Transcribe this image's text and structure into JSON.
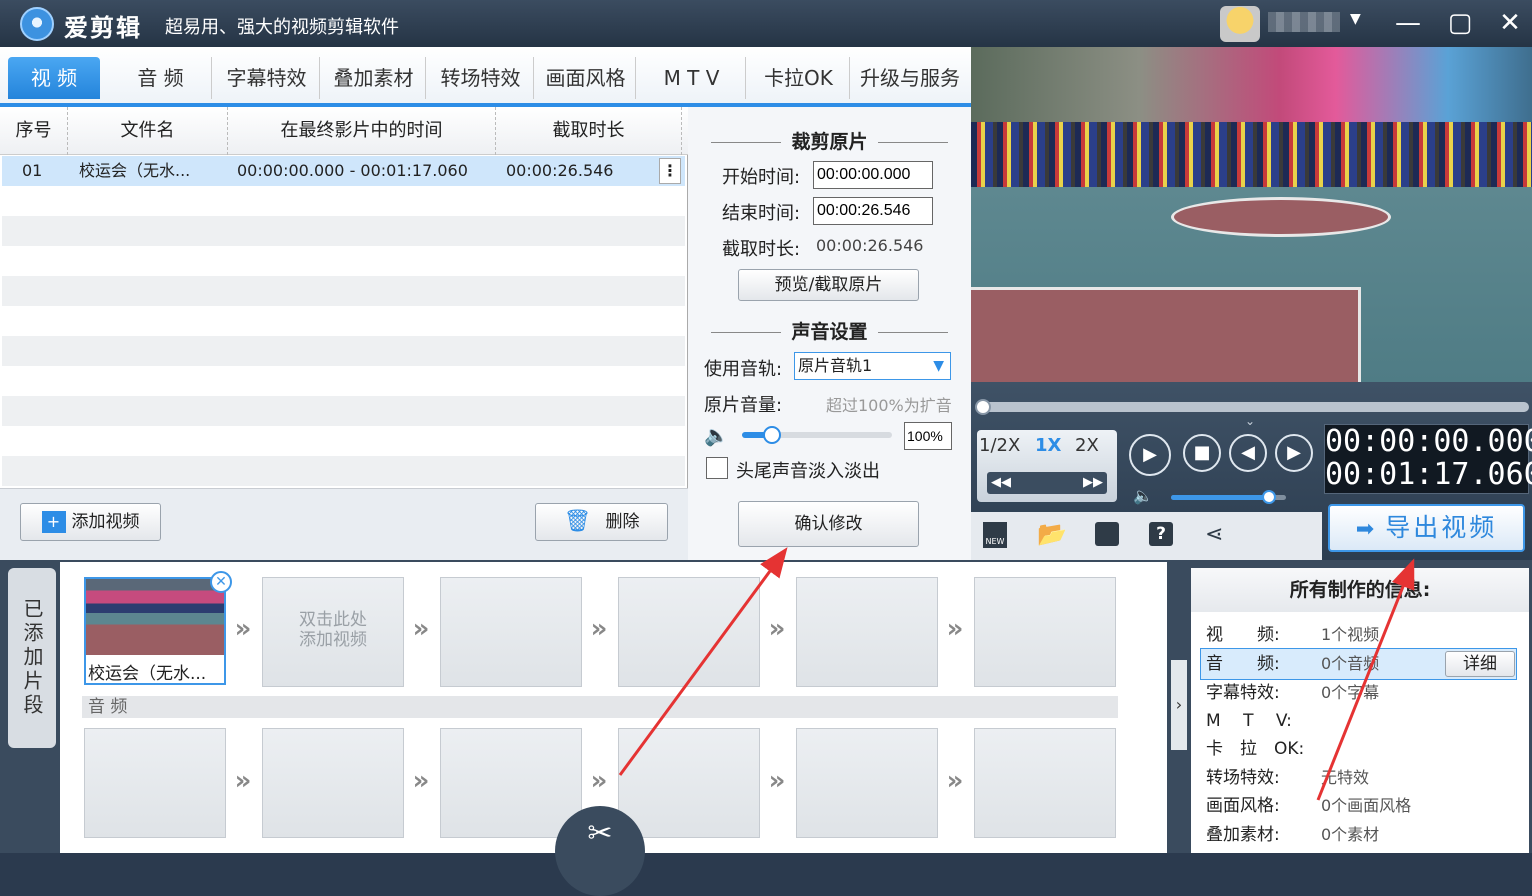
{
  "titlebar": {
    "app_name": "爱剪辑",
    "slogan": "超易用、强大的视频剪辑软件",
    "minimize": "—",
    "maximize": "▢",
    "close": "✕"
  },
  "tabs": [
    "视 频",
    "音 频",
    "字幕特效",
    "叠加素材",
    "转场特效",
    "画面风格",
    "M T V",
    "卡拉OK",
    "升级与服务"
  ],
  "table": {
    "headers": [
      "序号",
      "文件名",
      "在最终影片中的时间",
      "截取时长"
    ],
    "rows": [
      {
        "index": "01",
        "filename": "校运会（无水...",
        "time_range": "00:00:00.000 - 00:01:17.060",
        "duration": "00:00:26.546"
      }
    ]
  },
  "list_footer": {
    "add_video": "添加视频",
    "delete": "删除"
  },
  "edit": {
    "clip_section": "裁剪原片",
    "start_label": "开始时间:",
    "start_value": "00:00:00.000",
    "end_label": "结束时间:",
    "end_value": "00:00:26.546",
    "dur_label": "截取时长:",
    "dur_value": "00:00:26.546",
    "preview_btn": "预览/截取原片",
    "audio_section": "声音设置",
    "track_label": "使用音轨:",
    "track_value": "原片音轨1",
    "volume_label": "原片音量:",
    "volume_hint": "超过100%为扩音",
    "volume_value": "100%",
    "volume_level": 0.2,
    "fade_label": "头尾声音淡入淡出",
    "confirm_btn": "确认修改"
  },
  "player": {
    "speeds": [
      "1/2X",
      "1X",
      "2X"
    ],
    "timecode_current": "00:00:00.000",
    "timecode_total": "00:01:17.060",
    "volume_level": 0.85,
    "export": "导出视频"
  },
  "timeline": {
    "label": "已添加片段",
    "clip1_name": "校运会（无水...",
    "empty_hint_1": "双击此处",
    "empty_hint_2": "添加视频",
    "audio_label": "音 频"
  },
  "info": {
    "title": "所有制作的信息:",
    "rows": [
      {
        "label": "视　　频:",
        "value": "1个视频"
      },
      {
        "label": "音　　频:",
        "value": "0个音频"
      },
      {
        "label": "字幕特效:",
        "value": "0个字幕"
      },
      {
        "label": "M　 T　 V:",
        "value": ""
      },
      {
        "label": "卡　拉　OK:",
        "value": ""
      },
      {
        "label": "转场特效:",
        "value": "无特效"
      },
      {
        "label": "画面风格:",
        "value": "0个画面风格"
      },
      {
        "label": "叠加素材:",
        "value": "0个素材"
      }
    ],
    "detail_btn": "详细"
  }
}
